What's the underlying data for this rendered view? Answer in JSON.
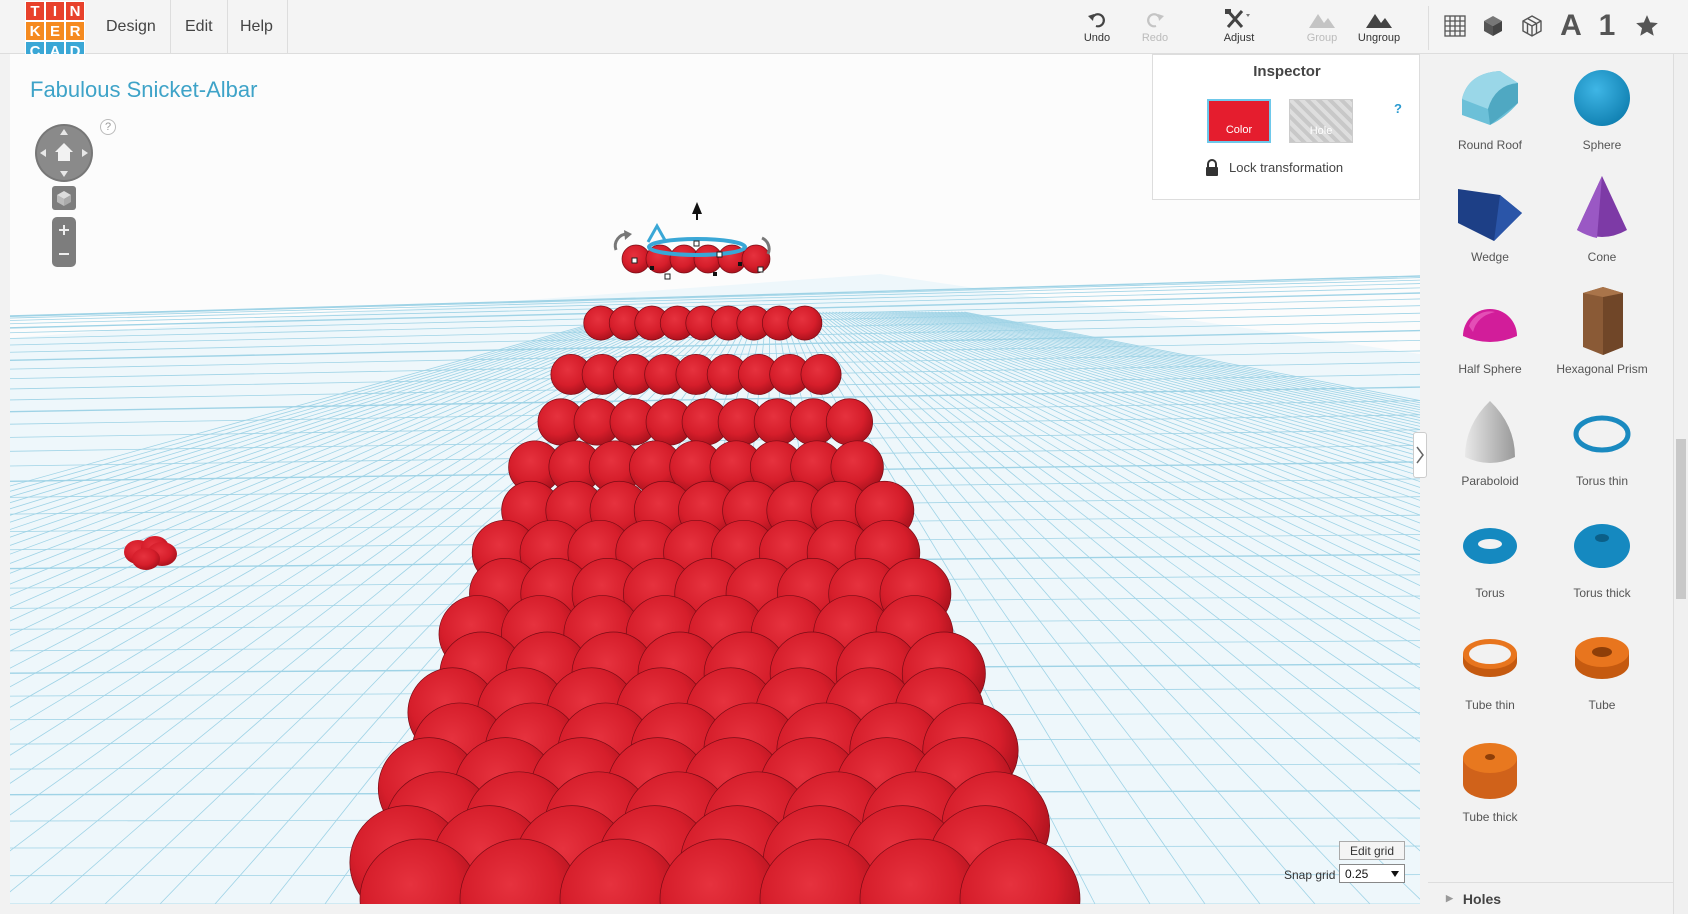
{
  "logo": {
    "letters": [
      "T",
      "I",
      "N",
      "K",
      "E",
      "R",
      "C",
      "A",
      "D"
    ],
    "colors": [
      "#e8412b",
      "#e8412b",
      "#e8412b",
      "#f58a1f",
      "#f58a1f",
      "#f58a1f",
      "#3aa7d6",
      "#3aa7d6",
      "#3aa7d6"
    ]
  },
  "menu": {
    "design": "Design",
    "edit": "Edit",
    "help": "Help"
  },
  "toolbar": {
    "undo": "Undo",
    "redo": "Redo",
    "adjust": "Adjust",
    "group": "Group",
    "ungroup": "Ungroup"
  },
  "shape_tools": {
    "text": "A",
    "number": "1"
  },
  "design": {
    "title": "Fabulous Snicket-Albar"
  },
  "nav": {
    "help": "?"
  },
  "inspector": {
    "title": "Inspector",
    "color_label": "Color",
    "hole_label": "Hole",
    "help": "?",
    "lock_label": "Lock transformation",
    "selected_color": "#e51d2e"
  },
  "grid": {
    "edit_label": "Edit grid",
    "snap_label": "Snap grid",
    "snap_value": "0.25"
  },
  "shapes": [
    {
      "name": "Round Roof",
      "icon": "round-roof"
    },
    {
      "name": "Sphere",
      "icon": "sphere"
    },
    {
      "name": "Wedge",
      "icon": "wedge"
    },
    {
      "name": "Cone",
      "icon": "cone"
    },
    {
      "name": "Half Sphere",
      "icon": "half-sphere"
    },
    {
      "name": "Hexagonal Prism",
      "icon": "hexagonal-prism"
    },
    {
      "name": "Paraboloid",
      "icon": "paraboloid"
    },
    {
      "name": "Torus thin",
      "icon": "torus-thin"
    },
    {
      "name": "Torus",
      "icon": "torus"
    },
    {
      "name": "Torus thick",
      "icon": "torus-thick"
    },
    {
      "name": "Tube thin",
      "icon": "tube-thin"
    },
    {
      "name": "Tube",
      "icon": "tube"
    },
    {
      "name": "Tube thick",
      "icon": "tube-thick"
    }
  ],
  "sections": {
    "holes": "Holes"
  }
}
